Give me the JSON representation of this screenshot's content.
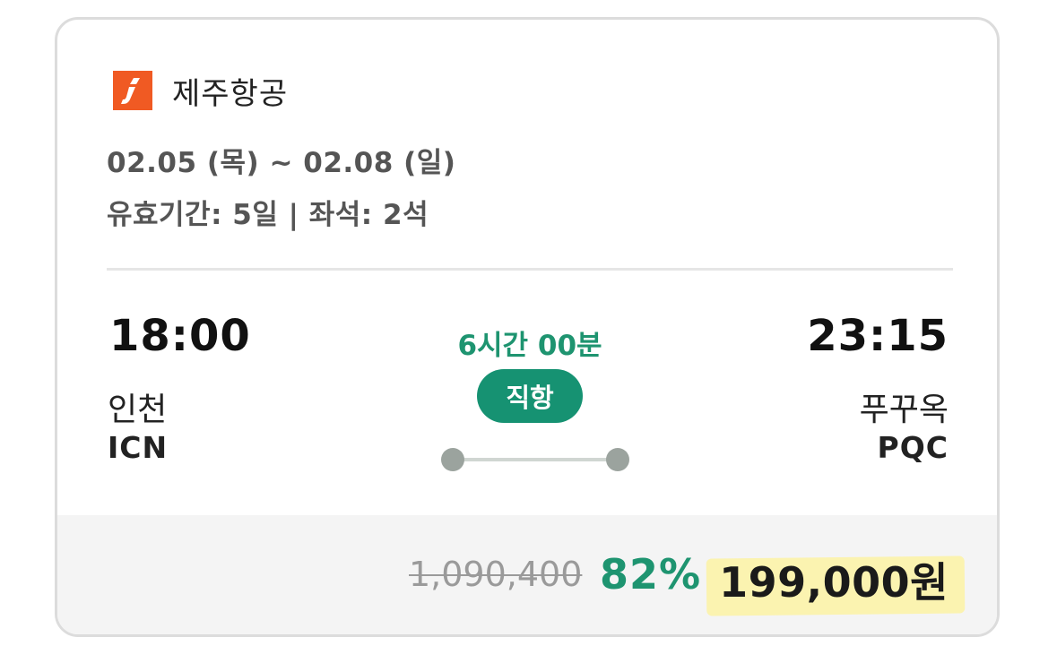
{
  "airline": {
    "name": "제주항공",
    "logo_letter": "j",
    "logo_color": "#f05a23"
  },
  "trip": {
    "dates": "02.05 (목) ~ 02.08 (일)",
    "validity": "유효기간: 5일 | 좌석: 2석"
  },
  "flight": {
    "departure": {
      "time": "18:00",
      "city": "인천",
      "code": "ICN"
    },
    "arrival": {
      "time": "23:15",
      "city": "푸꾸옥",
      "code": "PQC"
    },
    "duration": "6시간 00분",
    "type_badge": "직항"
  },
  "price": {
    "original": "1,090,400",
    "discount": "82%",
    "sale": "199,000원"
  },
  "colors": {
    "accent_green": "#1e9470",
    "badge_green": "#169272",
    "highlight_yellow": "#fbf3b0"
  }
}
